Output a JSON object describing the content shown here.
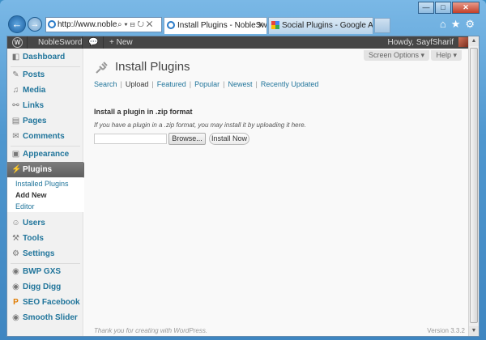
{
  "browser": {
    "back_label": "←",
    "forward_label": "→",
    "address": "http://www.noble...",
    "address_controls": "⌕ ▾ ⊟ ↻ ✕",
    "tabs": [
      {
        "title": "Install Plugins - NobleSwor...",
        "close": "✕"
      },
      {
        "title": "Social Plugins - Google Analyti...",
        "close": ""
      }
    ],
    "toolbar_icons": {
      "home": "⌂",
      "favorites": "★",
      "tools": "⚙"
    },
    "window_controls": {
      "minimize": "—",
      "maximize": "□",
      "close": "✕"
    }
  },
  "adminbar": {
    "site_name": "NobleSword",
    "comments_icon": "💬",
    "new_label": "+ New",
    "greeting": "Howdy, SayfSharif"
  },
  "sidebar": {
    "items": [
      {
        "label": "Dashboard",
        "icon": "◧"
      },
      {
        "label": "Posts",
        "icon": "✎"
      },
      {
        "label": "Media",
        "icon": "♫"
      },
      {
        "label": "Links",
        "icon": "⚯"
      },
      {
        "label": "Pages",
        "icon": "▤"
      },
      {
        "label": "Comments",
        "icon": "✉"
      },
      {
        "label": "Appearance",
        "icon": "▣"
      },
      {
        "label": "Plugins",
        "icon": "⚡"
      },
      {
        "label": "Users",
        "icon": "☺"
      },
      {
        "label": "Tools",
        "icon": "⚒"
      },
      {
        "label": "Settings",
        "icon": "⚙"
      },
      {
        "label": "BWP GXS",
        "icon": "◉"
      },
      {
        "label": "Digg Digg",
        "icon": "◉"
      },
      {
        "label": "SEO Facebook",
        "icon": "P"
      },
      {
        "label": "Smooth Slider",
        "icon": "◉"
      }
    ],
    "plugins_submenu": [
      {
        "label": "Installed Plugins"
      },
      {
        "label": "Add New"
      },
      {
        "label": "Editor"
      }
    ]
  },
  "main": {
    "screen_options": "Screen Options ▾",
    "help": "Help ▾",
    "title": "Install Plugins",
    "subnav": [
      {
        "label": "Search"
      },
      {
        "label": "Upload"
      },
      {
        "label": "Featured"
      },
      {
        "label": "Popular"
      },
      {
        "label": "Newest"
      },
      {
        "label": "Recently Updated"
      }
    ],
    "upload_heading": "Install a plugin in .zip format",
    "upload_desc": "If you have a plugin in a .zip format, you may install it by uploading it here.",
    "file_input_value": "",
    "browse_label": "Browse...",
    "install_label": "Install Now",
    "footer_left": "Thank you for creating with WordPress.",
    "footer_right": "Version 3.3.2"
  }
}
